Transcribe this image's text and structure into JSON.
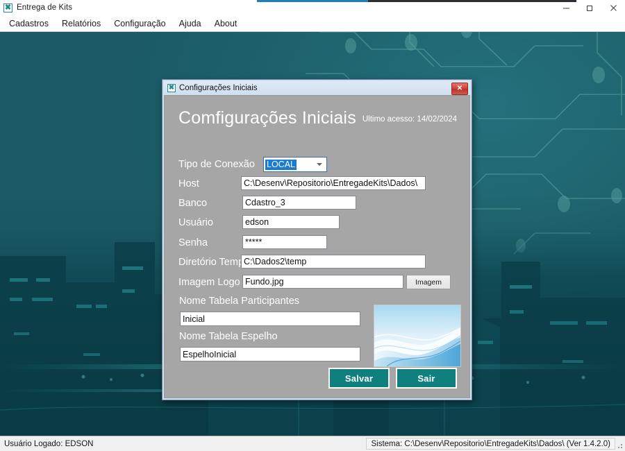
{
  "window": {
    "title": "Entrega de Kits",
    "app_icon": "app-logo-icon",
    "minimize_label": "—",
    "maximize_label": "❐",
    "close_label": "✕"
  },
  "menubar": {
    "items": [
      {
        "label": "Cadastros"
      },
      {
        "label": "Relatórios"
      },
      {
        "label": "Configuração"
      },
      {
        "label": "Ajuda"
      },
      {
        "label": "About"
      }
    ]
  },
  "dialog": {
    "titlebar_text": "Configurações Iniciais",
    "close_label": "✕",
    "heading": "Comfigurações Iniciais",
    "last_access": "Ultimo acesso: 14/02/2024",
    "fields": {
      "tipo_conexao": {
        "label": "Tipo de Conexão",
        "value": "LOCAL",
        "options": [
          "LOCAL"
        ]
      },
      "host": {
        "label": "Host",
        "value": "C:\\Desenv\\Repositorio\\EntregadeKits\\Dados\\"
      },
      "banco": {
        "label": "Banco",
        "value": "Cdastro_3"
      },
      "usuario": {
        "label": "Usuário",
        "value": "edson"
      },
      "senha": {
        "label": "Senha",
        "value": "*****"
      },
      "diretorio_temp": {
        "label": "Diretório Temp",
        "value": "C:\\Dados2\\temp"
      },
      "imagem_logo": {
        "label": "Imagem Logo",
        "value": "Fundo.jpg",
        "browse_button": "Imagem"
      },
      "nome_tabela_participantes": {
        "label": "Nome Tabela Participantes",
        "value": "Inicial"
      },
      "nome_tabela_espelho": {
        "label": "Nome Tabela Espelho",
        "value": "EspelhoInicial"
      }
    },
    "buttons": {
      "save": "Salvar",
      "exit": "Sair"
    }
  },
  "statusbar": {
    "user_text": "Usuário Logado: EDSON",
    "system_text": "Sistema: C:\\Desenv\\Repositorio\\EntregadeKits\\Dados\\ (Ver 1.4.2.0)"
  },
  "colors": {
    "desktop_teal": "#1d6069",
    "dialog_body_gray": "#a6a6a6",
    "dialog_frame_blue": "#cfe0f2",
    "button_teal": "#10807f",
    "close_red": "#cf4236",
    "combo_highlight": "#1a7bd4"
  }
}
